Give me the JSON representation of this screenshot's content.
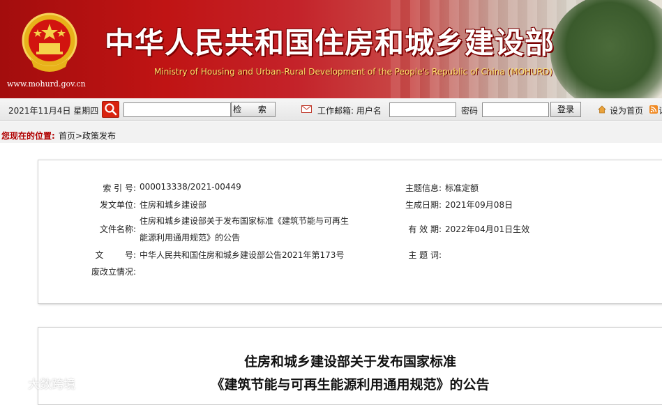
{
  "banner": {
    "title": "中华人民共和国住房和城乡建设部",
    "subtitle": "Ministry of Housing and Urban-Rural Development of the People's Republic of China (MOHURD)",
    "url": "www.mohurd.gov.cn",
    "emblem_icon": "national-emblem"
  },
  "toolbar": {
    "date": "2021年11月4日  星期四",
    "search_placeholder": "",
    "search_button": "检 索",
    "mail_label": "工作邮箱:  用户名",
    "password_label": "密码",
    "login_button": "登录",
    "set_home": "设为首页",
    "rss_label": "订阅"
  },
  "breadcrumb": {
    "label": "您现在的位置:",
    "path": "首页>政策发布"
  },
  "meta": {
    "index_label": "索 引 号:",
    "index_value": "000013338/2021-00449",
    "issuer_label": "发文单位:",
    "issuer_value": "住房和城乡建设部",
    "filename_label": "文件名称:",
    "filename_line1": "住房和城乡建设部关于发布国家标准《建筑节能与可再生",
    "filename_line2": "能源利用通用规范》的公告",
    "docno_label": "文        号:",
    "docno_value": "中华人民共和国住房和城乡建设部公告2021年第173号",
    "status_label": "废改立情况:",
    "status_value": "",
    "topic_label": "主题信息:",
    "topic_value": "标准定额",
    "created_label": "生成日期:",
    "created_value": "2021年09月08日",
    "effective_label": "有 效 期:",
    "effective_value": "2022年04月01日生效",
    "keywords_label": "主 题 词:",
    "keywords_value": ""
  },
  "article": {
    "title_line1": "住房和城乡建设部关于发布国家标准",
    "title_line2": "《建筑节能与可再生能源利用通用规范》的公告"
  },
  "watermark": "大数跨境",
  "colors": {
    "banner_red": "#c01414",
    "title_shadow": "#7a0000",
    "subtitle_yellow": "#ffe36a",
    "crumb_red": "#b00000",
    "search_red": "#d9230f"
  }
}
